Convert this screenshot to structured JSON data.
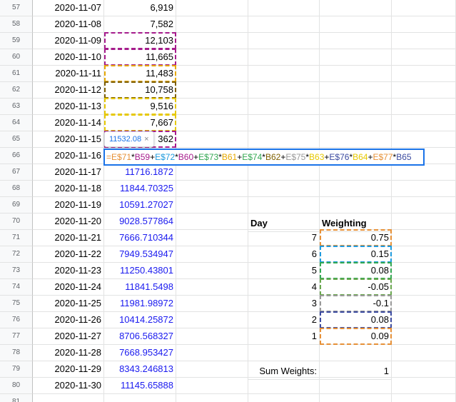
{
  "rows": [
    {
      "num": "57",
      "date": "2020-11-07",
      "value": "6,919",
      "value_color": "black"
    },
    {
      "num": "58",
      "date": "2020-11-08",
      "value": "7,582",
      "value_color": "black"
    },
    {
      "num": "59",
      "date": "2020-11-09",
      "value": "12,103",
      "value_color": "black"
    },
    {
      "num": "60",
      "date": "2020-11-10",
      "value": "11,665",
      "value_color": "black"
    },
    {
      "num": "61",
      "date": "2020-11-11",
      "value": "11,483",
      "value_color": "black"
    },
    {
      "num": "62",
      "date": "2020-11-12",
      "value": "10,758",
      "value_color": "black"
    },
    {
      "num": "63",
      "date": "2020-11-13",
      "value": "9,516",
      "value_color": "black"
    },
    {
      "num": "64",
      "date": "2020-11-14",
      "value": "7,667",
      "value_color": "black"
    },
    {
      "num": "65",
      "date": "2020-11-15",
      "value": "362",
      "value_color": "black"
    },
    {
      "num": "66",
      "date": "2020-11-16",
      "value": "",
      "value_color": "black"
    },
    {
      "num": "67",
      "date": "2020-11-17",
      "value": "11716.1872",
      "value_color": "blue"
    },
    {
      "num": "68",
      "date": "2020-11-18",
      "value": "11844.70325",
      "value_color": "blue"
    },
    {
      "num": "69",
      "date": "2020-11-19",
      "value": "10591.27027",
      "value_color": "blue"
    },
    {
      "num": "70",
      "date": "2020-11-20",
      "value": "9028.577864",
      "value_color": "blue"
    },
    {
      "num": "71",
      "date": "2020-11-21",
      "value": "7666.710344",
      "value_color": "blue"
    },
    {
      "num": "72",
      "date": "2020-11-22",
      "value": "7949.534947",
      "value_color": "blue"
    },
    {
      "num": "73",
      "date": "2020-11-23",
      "value": "11250.43801",
      "value_color": "blue"
    },
    {
      "num": "74",
      "date": "2020-11-24",
      "value": "11841.5498",
      "value_color": "blue"
    },
    {
      "num": "75",
      "date": "2020-11-25",
      "value": "11981.98972",
      "value_color": "blue"
    },
    {
      "num": "76",
      "date": "2020-11-26",
      "value": "10414.25872",
      "value_color": "blue"
    },
    {
      "num": "77",
      "date": "2020-11-27",
      "value": "8706.568327",
      "value_color": "blue"
    },
    {
      "num": "78",
      "date": "2020-11-28",
      "value": "7668.953427",
      "value_color": "blue"
    },
    {
      "num": "79",
      "date": "2020-11-29",
      "value": "8343.246813",
      "value_color": "blue"
    },
    {
      "num": "80",
      "date": "2020-11-30",
      "value": "11145.65888",
      "value_color": "blue"
    },
    {
      "num": "81",
      "date": "",
      "value": "",
      "value_color": "black"
    }
  ],
  "weights_table": {
    "day_header": "Day",
    "weighting_header": "Weighting",
    "entries": [
      {
        "day": "7",
        "weight": "0.75"
      },
      {
        "day": "6",
        "weight": "0.15"
      },
      {
        "day": "5",
        "weight": "0.08"
      },
      {
        "day": "4",
        "weight": "-0.05"
      },
      {
        "day": "3",
        "weight": "-0.1"
      },
      {
        "day": "2",
        "weight": "0.08"
      },
      {
        "day": "1",
        "weight": "0.09"
      }
    ],
    "sum_label": "Sum Weights:",
    "sum_value": "1"
  },
  "formula_tooltip": {
    "value": "11532.08",
    "close_glyph": "×"
  },
  "formula_parts": [
    {
      "text": "=",
      "color": "#e69138"
    },
    {
      "text": "E$71",
      "color": "#e69138"
    },
    {
      "text": "*",
      "color": "#000000"
    },
    {
      "text": "B59",
      "color": "#a61c8c"
    },
    {
      "text": "+",
      "color": "#000000"
    },
    {
      "text": "E$72",
      "color": "#1f9bde"
    },
    {
      "text": "*",
      "color": "#000000"
    },
    {
      "text": "B60",
      "color": "#a61c8c"
    },
    {
      "text": "+",
      "color": "#000000"
    },
    {
      "text": "E$73",
      "color": "#34a853"
    },
    {
      "text": "*",
      "color": "#000000"
    },
    {
      "text": "B61",
      "color": "#e6a800"
    },
    {
      "text": "+",
      "color": "#000000"
    },
    {
      "text": "E$74",
      "color": "#34a853"
    },
    {
      "text": "*",
      "color": "#000000"
    },
    {
      "text": "B62",
      "color": "#7f6000"
    },
    {
      "text": "+",
      "color": "#000000"
    },
    {
      "text": "E$75",
      "color": "#999999"
    },
    {
      "text": "*",
      "color": "#000000"
    },
    {
      "text": "B63",
      "color": "#e6c800"
    },
    {
      "text": "+",
      "color": "#000000"
    },
    {
      "text": "E$76",
      "color": "#3c4ba0"
    },
    {
      "text": "*",
      "color": "#000000"
    },
    {
      "text": "B64",
      "color": "#e6c800"
    },
    {
      "text": "+",
      "color": "#000000"
    },
    {
      "text": "E$77",
      "color": "#e69138"
    },
    {
      "text": "*",
      "color": "#000000"
    },
    {
      "text": "B65",
      "color": "#3c4ba0"
    }
  ],
  "colors": {
    "formula_border": "#1a73e8",
    "value_blue": "#1a1aef",
    "ref_b59": "#a61c8c",
    "ref_b60": "#a61c8c",
    "ref_b61": "#e6a800",
    "ref_b62": "#7f6000",
    "ref_b63": "#e6c800",
    "ref_b64": "#e6c800",
    "ref_b65": "#a61c8c",
    "ref_e71": "#e69138",
    "ref_e72": "#1f9bde",
    "ref_e73": "#34a853",
    "ref_e74": "#6aa84f",
    "ref_e75": "#999999",
    "ref_e76": "#3c4ba0",
    "ref_e77": "#e69138"
  }
}
